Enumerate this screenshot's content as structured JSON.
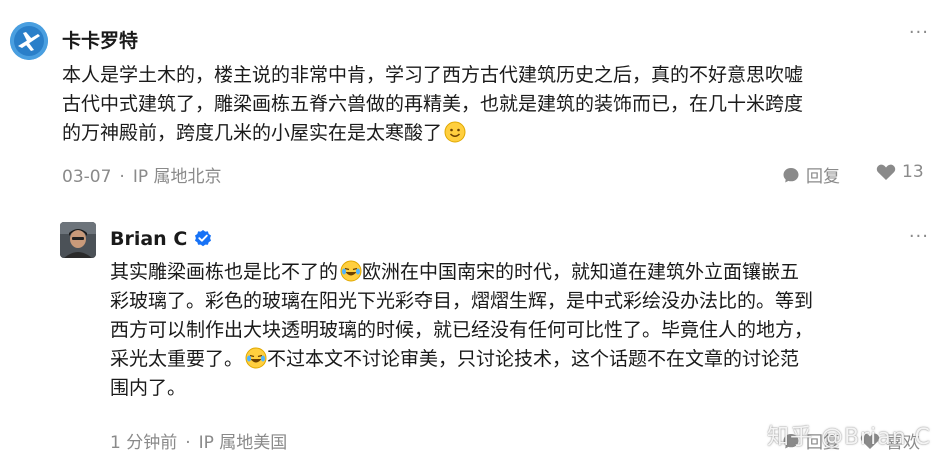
{
  "comments": [
    {
      "author": "卡卡罗特",
      "avatar_icon": "airplane-avatar-icon",
      "lines": [
        "本人是学土木的，楼主说的非常中肯，学习了西方古代建筑历史之后，真的不好意思吹嘘",
        "古代中式建筑了，雕梁画栋五脊六兽做的再精美，也就是建筑的装饰而已，在几十米跨度",
        "的万神殿前，跨度几米的小屋实在是太寒酸了"
      ],
      "emoji": "smile-emoji-icon",
      "date": "03-07",
      "location": "IP 属地北京",
      "reply_label": "回复",
      "like_count": "13",
      "more_label": "···"
    },
    {
      "author": "Brian C",
      "verified_icon": "verified-badge-icon",
      "line1_a": "其实雕梁画栋也是比不了的",
      "line1_b": "欧洲在中国南宋的时代，就知道在建筑外立面镶嵌五",
      "line2": "彩玻璃了。彩色的玻璃在阳光下光彩夺目，熠熠生辉，是中式彩绘没办法比的。等到",
      "line3": "西方可以制作出大块透明玻璃的时候，就已经没有任何可比性了。毕竟住人的地方，",
      "line4_b": "不过本文不讨论审美，只讨论技术，这个话题不在文章的讨论范",
      "line4_a": "采光太重要了。",
      "line5": "围内了。",
      "time": "1 分钟前",
      "location": "IP 属地美国",
      "reply_label": "回复",
      "like_label": "喜欢",
      "more_label": "···"
    }
  ],
  "watermark": "知乎 @Brian C",
  "colors": {
    "meta": "#8a8a8a",
    "verified": "#1772f6",
    "avatar_bg": "#2e8fd6"
  }
}
